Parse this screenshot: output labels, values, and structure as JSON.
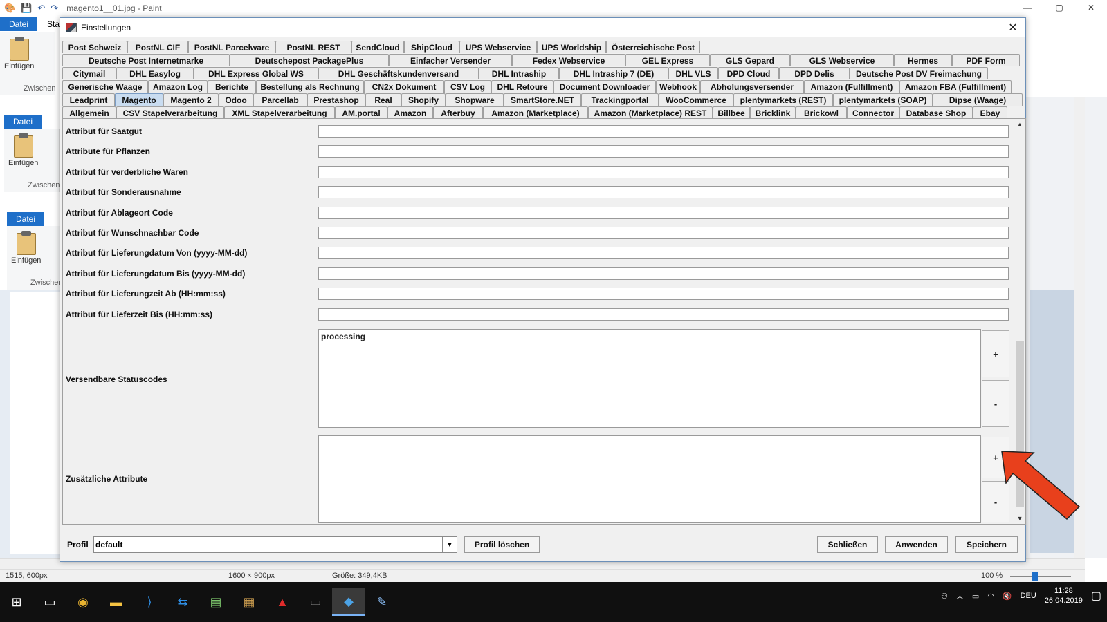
{
  "paint": {
    "title": "magento1__01.jpg - Paint",
    "datei": "Datei",
    "paste": "Einfügen",
    "group": "Zwischen",
    "tab_start": "Sta",
    "status": {
      "cursor": "1515, 600px",
      "size": "1600 × 900px",
      "filesize": "Größe: 349,4KB",
      "zoom": "100 %"
    }
  },
  "dialog": {
    "title": "Einstellungen",
    "tab_rows": [
      [
        "Post Schweiz",
        "PostNL CIF",
        "PostNL Parcelware",
        "PostNL REST",
        "SendCloud",
        "ShipCloud",
        "UPS Webservice",
        "UPS Worldship",
        "Österreichische Post"
      ],
      [
        "Deutsche Post Internetmarke",
        "Deutschepost PackagePlus",
        "Einfacher Versender",
        "Fedex Webservice",
        "GEL Express",
        "GLS Gepard",
        "GLS Webservice",
        "Hermes",
        "PDF Form"
      ],
      [
        "Citymail",
        "DHL Easylog",
        "DHL Express Global WS",
        "DHL Geschäftskundenversand",
        "DHL Intraship",
        "DHL Intraship 7 (DE)",
        "DHL VLS",
        "DPD Cloud",
        "DPD Delis",
        "Deutsche Post DV Freimachung"
      ],
      [
        "Generische Waage",
        "Amazon Log",
        "Berichte",
        "Bestellung als Rechnung",
        "CN2x Dokument",
        "CSV Log",
        "DHL Retoure",
        "Document Downloader",
        "Webhook",
        "Abholungsversender",
        "Amazon (Fulfillment)",
        "Amazon FBA (Fulfillment)"
      ],
      [
        "Leadprint",
        "Magento",
        "Magento 2",
        "Odoo",
        "Parcellab",
        "Prestashop",
        "Real",
        "Shopify",
        "Shopware",
        "SmartStore.NET",
        "Trackingportal",
        "WooCommerce",
        "plentymarkets (REST)",
        "plentymarkets (SOAP)",
        "Dipse (Waage)"
      ],
      [
        "Allgemein",
        "CSV Stapelverarbeitung",
        "XML Stapelverarbeitung",
        "AM.portal",
        "Amazon",
        "Afterbuy",
        "Amazon (Marketplace)",
        "Amazon (Marketplace) REST",
        "Billbee",
        "Bricklink",
        "Brickowl",
        "Connector",
        "Database Shop",
        "Ebay"
      ]
    ],
    "selected_tab": "Magento",
    "fields": [
      {
        "label": "Attribut für Saatgut",
        "value": ""
      },
      {
        "label": "Attribute für Pflanzen",
        "value": ""
      },
      {
        "label": "Attribut für verderbliche Waren",
        "value": ""
      },
      {
        "label": "Attribut für Sonderausnahme",
        "value": ""
      },
      {
        "label": "Attribut für Ablageort Code",
        "value": ""
      },
      {
        "label": "Attribut für Wunschnachbar Code",
        "value": ""
      },
      {
        "label": "Attribut für Lieferungdatum Von (yyyy-MM-dd)",
        "value": ""
      },
      {
        "label": "Attribut für Lieferungdatum Bis (yyyy-MM-dd)",
        "value": ""
      },
      {
        "label": "Attribut für Lieferungzeit Ab (HH:mm:ss)",
        "value": ""
      },
      {
        "label": "Attribut für Lieferzeit Bis (HH:mm:ss)",
        "value": ""
      }
    ],
    "status_codes": {
      "label": "Versendbare Statuscodes",
      "value": "processing",
      "add": "+",
      "remove": "-"
    },
    "extra_attrs": {
      "label": "Zusätzliche Attribute",
      "value": "",
      "add": "+",
      "remove": "-"
    },
    "footer": {
      "profile_label": "Profil",
      "profile_value": "default",
      "delete_profile": "Profil löschen",
      "close": "Schließen",
      "apply": "Anwenden",
      "save": "Speichern"
    }
  },
  "taskbar": {
    "lang": "DEU",
    "time": "11:28",
    "date": "26.04.2019"
  },
  "colors": {
    "selected_tab": "#c9dcf0",
    "arrow": "#e8401c",
    "taskbar": "#101010"
  }
}
